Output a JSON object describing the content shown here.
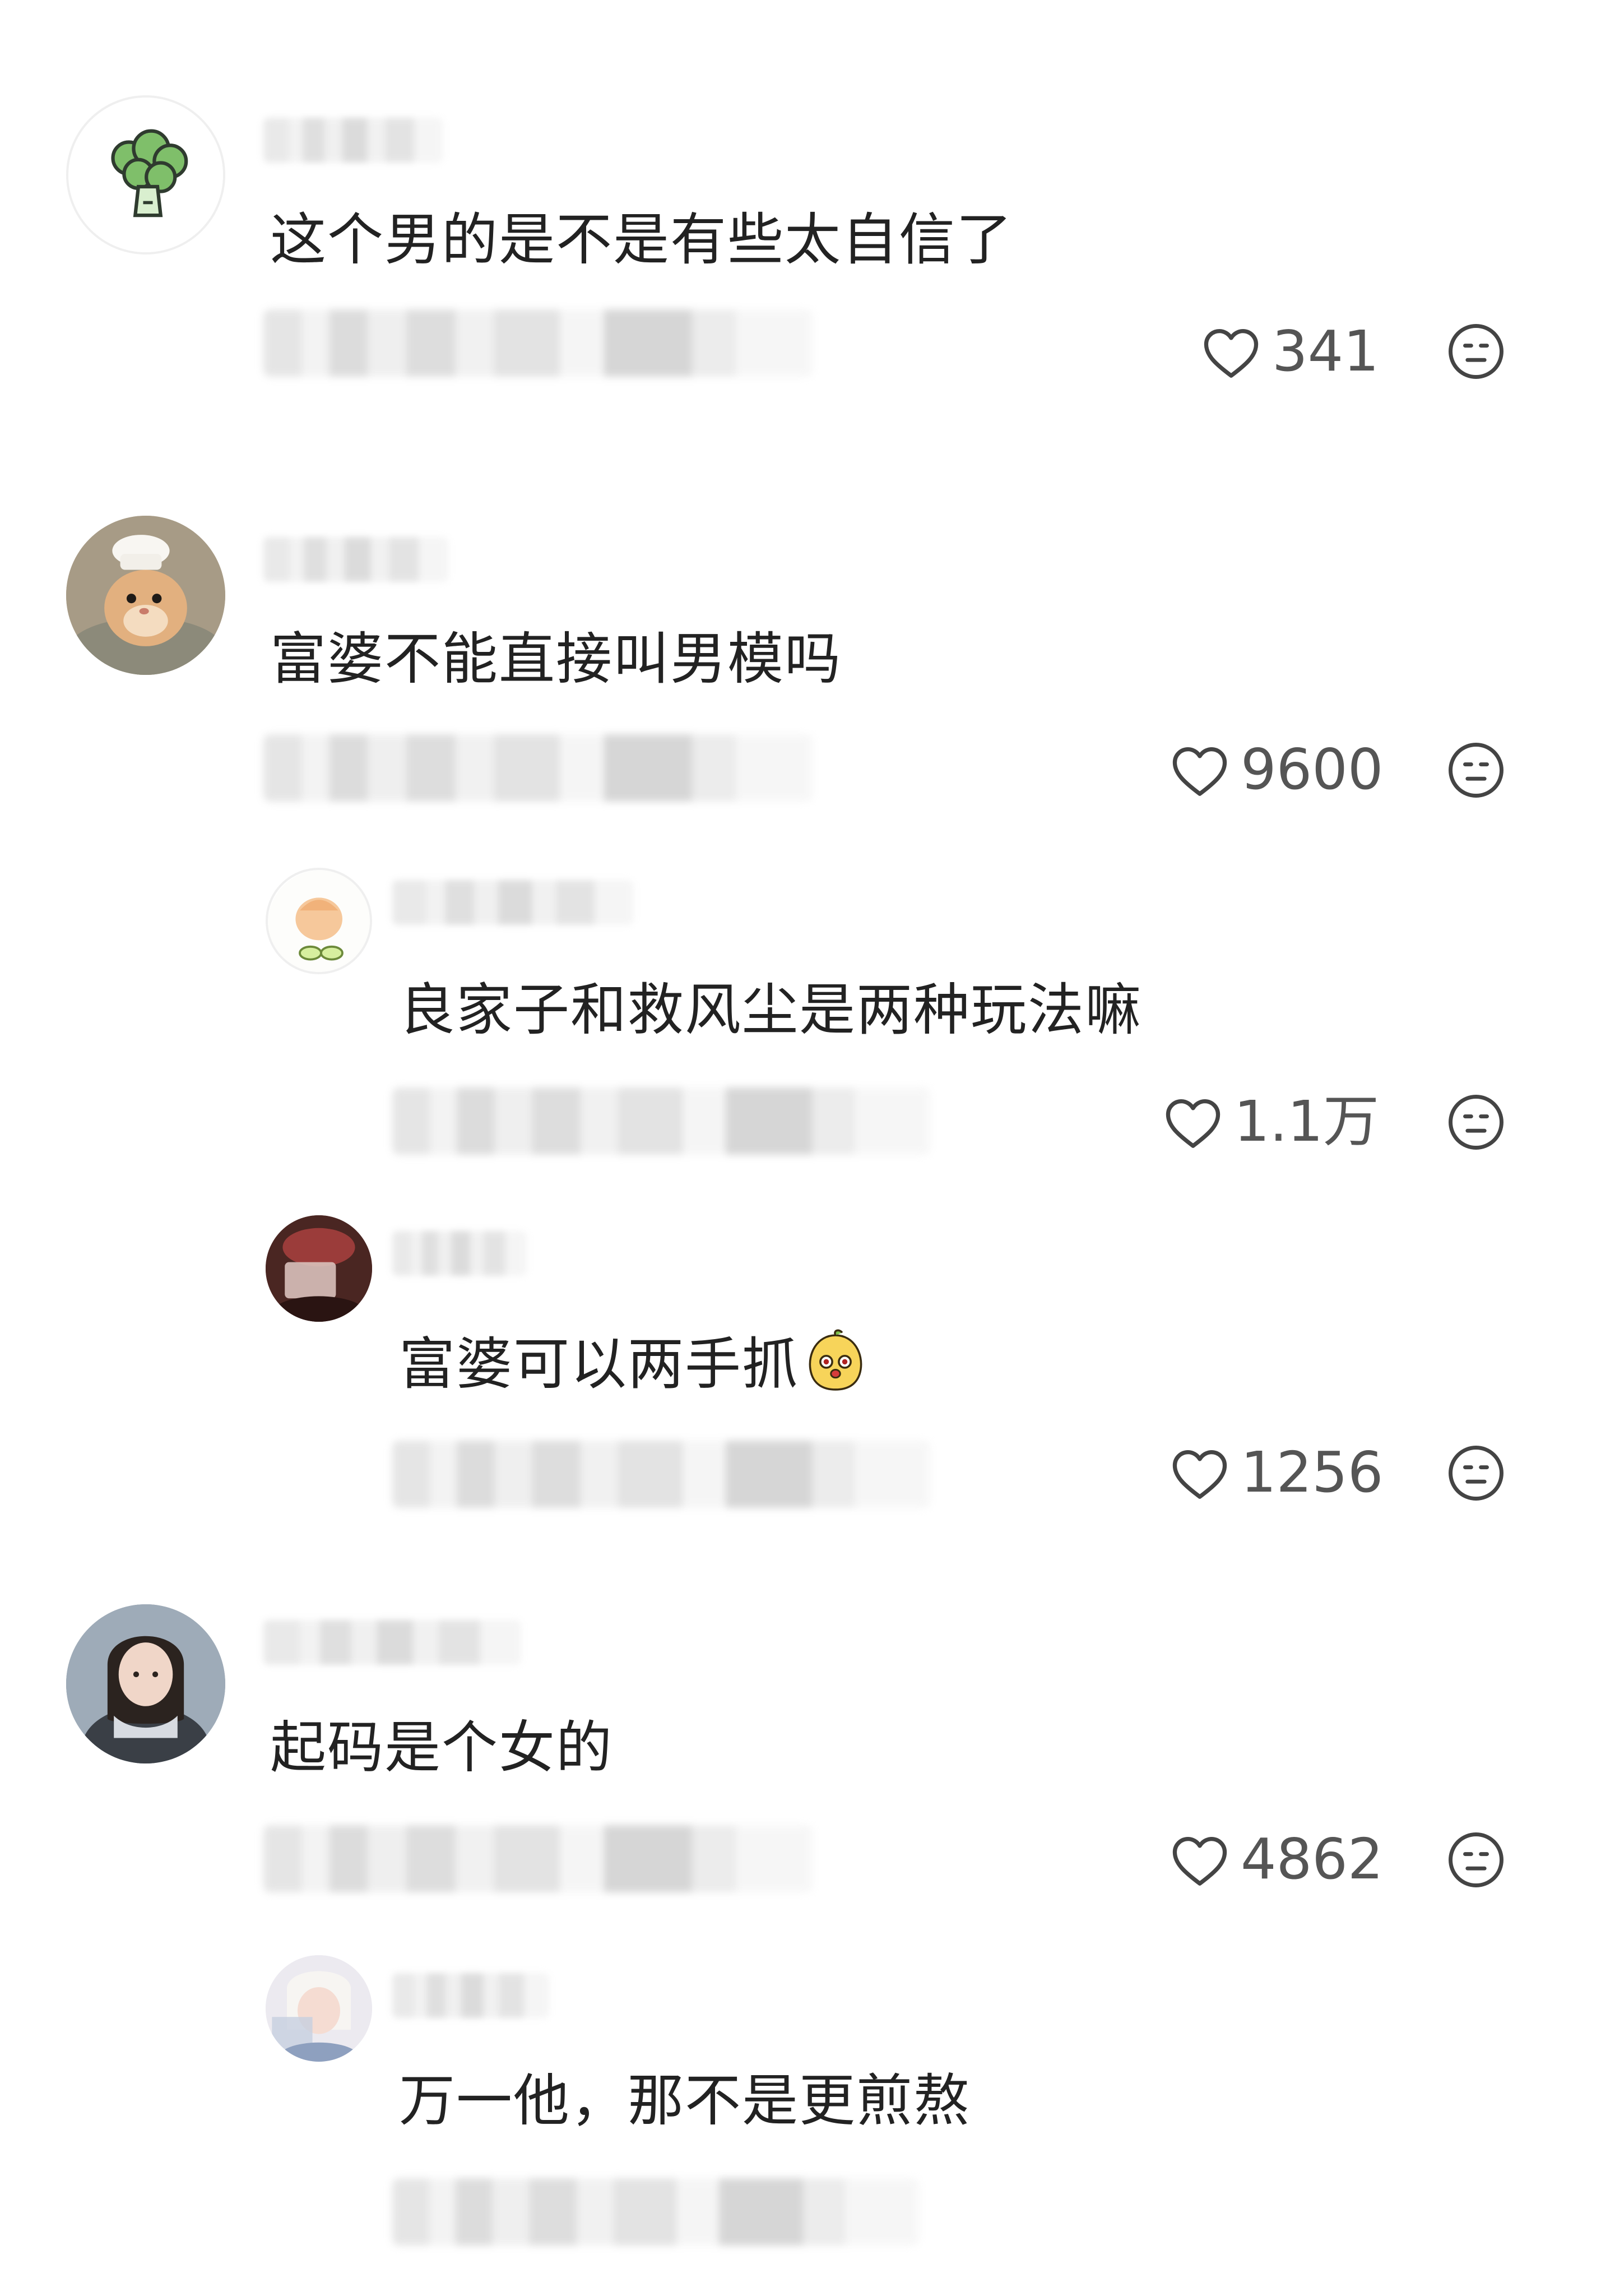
{
  "comments": [
    {
      "level": "top",
      "avatar": "broccoli-avatar",
      "text": "这个男的是不是有些太自信了",
      "likes": "341"
    },
    {
      "level": "top",
      "avatar": "hamster-chef-avatar",
      "text": "富婆不能直接叫男模吗",
      "likes": "9600"
    },
    {
      "level": "reply",
      "avatar": "cartoon-avatar",
      "text": "良家子和救风尘是两种玩法嘛",
      "likes": "1.1万"
    },
    {
      "level": "reply",
      "avatar": "dark-photo-avatar",
      "text": "富婆可以两手抓",
      "emoji": "mango-emoji",
      "likes": "1256"
    },
    {
      "level": "top",
      "avatar": "girl-portrait-avatar",
      "text": "起码是个女的",
      "likes": "4862"
    },
    {
      "level": "reply",
      "avatar": "anime-avatar",
      "text": "万一他，那不是更煎熬",
      "likes": ""
    }
  ],
  "icons": {
    "like": "heart-outline-icon",
    "dislike": "neutral-face-icon"
  },
  "colors": {
    "text": "#222222",
    "meta": "#555555",
    "icon": "#444444"
  }
}
